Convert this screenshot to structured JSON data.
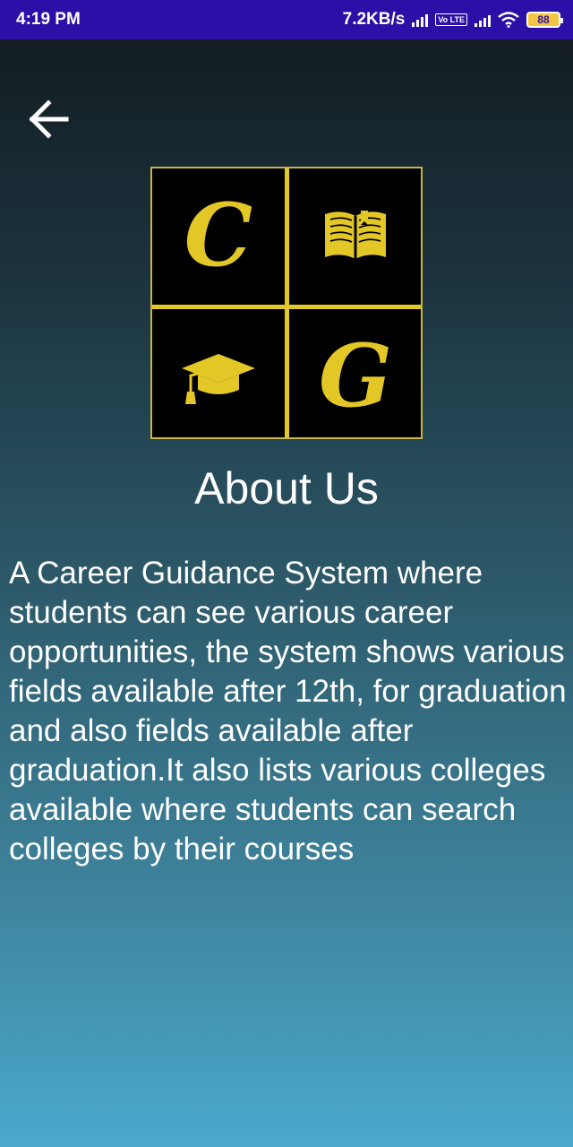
{
  "status_bar": {
    "time": "4:19 PM",
    "network_speed": "7.2KB/s",
    "volte_label": "Vo LTE",
    "battery_level": "88",
    "icons": [
      "signal-icon",
      "volte-icon",
      "signal-icon",
      "wifi-icon",
      "battery-icon"
    ]
  },
  "toolbar": {
    "back_icon": "arrow-left-icon"
  },
  "logo": {
    "letters": {
      "top_left": "C",
      "bottom_right": "G"
    },
    "icons": [
      "book-icon",
      "graduation-cap-icon"
    ],
    "accent_color": "#e3c726"
  },
  "page": {
    "title": "About Us",
    "description": "A Career Guidance System where students can see various career opportunities, the system shows various fields available after 12th, for graduation and also fields available after graduation.It also lists various colleges available where students can search colleges by their courses"
  },
  "colors": {
    "status_bar": "#2c0fa6",
    "bg_top": "#121a1d",
    "bg_bottom": "#4aa9cc"
  }
}
